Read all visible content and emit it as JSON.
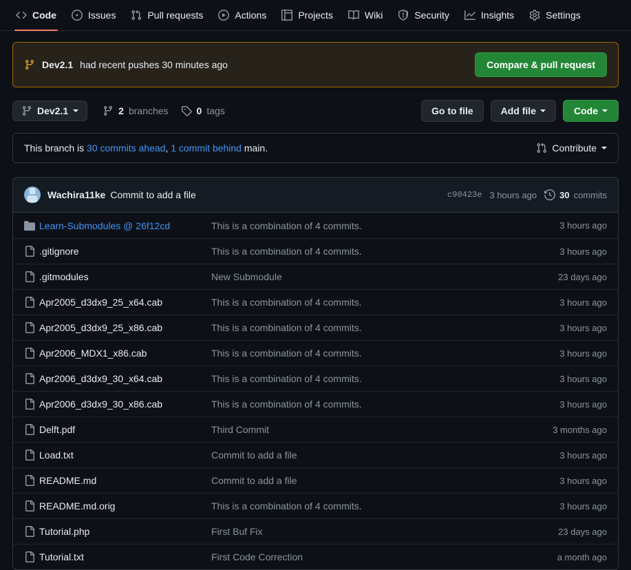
{
  "nav": {
    "tabs": [
      {
        "label": "Code",
        "icon": "code-icon",
        "active": true
      },
      {
        "label": "Issues",
        "icon": "issue-icon",
        "active": false
      },
      {
        "label": "Pull requests",
        "icon": "pr-icon",
        "active": false
      },
      {
        "label": "Actions",
        "icon": "play-icon",
        "active": false
      },
      {
        "label": "Projects",
        "icon": "table-icon",
        "active": false
      },
      {
        "label": "Wiki",
        "icon": "book-icon",
        "active": false
      },
      {
        "label": "Security",
        "icon": "shield-icon",
        "active": false
      },
      {
        "label": "Insights",
        "icon": "graph-icon",
        "active": false
      },
      {
        "label": "Settings",
        "icon": "gear-icon",
        "active": false
      }
    ]
  },
  "push_banner": {
    "branch": "Dev2.1",
    "message": "had recent pushes 30 minutes ago",
    "button_label": "Compare & pull request",
    "accent_color": "#9e6a03",
    "button_color": "#238636"
  },
  "toolbar": {
    "branch_name": "Dev2.1",
    "branches_count": "2",
    "branches_label": "branches",
    "tags_count": "0",
    "tags_label": "tags",
    "go_to_file": "Go to file",
    "add_file": "Add file",
    "code": "Code"
  },
  "compare": {
    "prefix": "This branch is",
    "ahead": "30 commits ahead",
    "separator": ",",
    "behind": "1 commit behind",
    "suffix": "main.",
    "contribute_label": "Contribute",
    "link_color": "#4493f8"
  },
  "commit_header": {
    "author": "Wachira11ke",
    "message": "Commit to add a file",
    "sha": "c90423e",
    "time": "3 hours ago",
    "commits_count": "30",
    "commits_label": "commits"
  },
  "files": [
    {
      "name": "Learn-Submodules @ 26f12cd",
      "icon": "submodule-icon",
      "is_link": true,
      "message": "This is a combination of 4 commits.",
      "time": "3 hours ago"
    },
    {
      "name": ".gitignore",
      "icon": "file-icon",
      "is_link": false,
      "message": "This is a combination of 4 commits.",
      "time": "3 hours ago"
    },
    {
      "name": ".gitmodules",
      "icon": "file-icon",
      "is_link": false,
      "message": "New Submodule",
      "time": "23 days ago"
    },
    {
      "name": "Apr2005_d3dx9_25_x64.cab",
      "icon": "file-icon",
      "is_link": false,
      "message": "This is a combination of 4 commits.",
      "time": "3 hours ago"
    },
    {
      "name": "Apr2005_d3dx9_25_x86.cab",
      "icon": "file-icon",
      "is_link": false,
      "message": "This is a combination of 4 commits.",
      "time": "3 hours ago"
    },
    {
      "name": "Apr2006_MDX1_x86.cab",
      "icon": "file-icon",
      "is_link": false,
      "message": "This is a combination of 4 commits.",
      "time": "3 hours ago"
    },
    {
      "name": "Apr2006_d3dx9_30_x64.cab",
      "icon": "file-icon",
      "is_link": false,
      "message": "This is a combination of 4 commits.",
      "time": "3 hours ago"
    },
    {
      "name": "Apr2006_d3dx9_30_x86.cab",
      "icon": "file-icon",
      "is_link": false,
      "message": "This is a combination of 4 commits.",
      "time": "3 hours ago"
    },
    {
      "name": "Delft.pdf",
      "icon": "file-icon",
      "is_link": false,
      "message": "Third Commit",
      "time": "3 months ago"
    },
    {
      "name": "Load.txt",
      "icon": "file-icon",
      "is_link": false,
      "message": "Commit to add a file",
      "time": "3 hours ago"
    },
    {
      "name": "README.md",
      "icon": "file-icon",
      "is_link": false,
      "message": "Commit to add a file",
      "time": "3 hours ago"
    },
    {
      "name": "README.md.orig",
      "icon": "file-icon",
      "is_link": false,
      "message": "This is a combination of 4 commits.",
      "time": "3 hours ago"
    },
    {
      "name": "Tutorial.php",
      "icon": "file-icon",
      "is_link": false,
      "message": "First Buf Fix",
      "time": "23 days ago"
    },
    {
      "name": "Tutorial.txt",
      "icon": "file-icon",
      "is_link": false,
      "message": "First Code Correction",
      "time": "a month ago"
    }
  ]
}
